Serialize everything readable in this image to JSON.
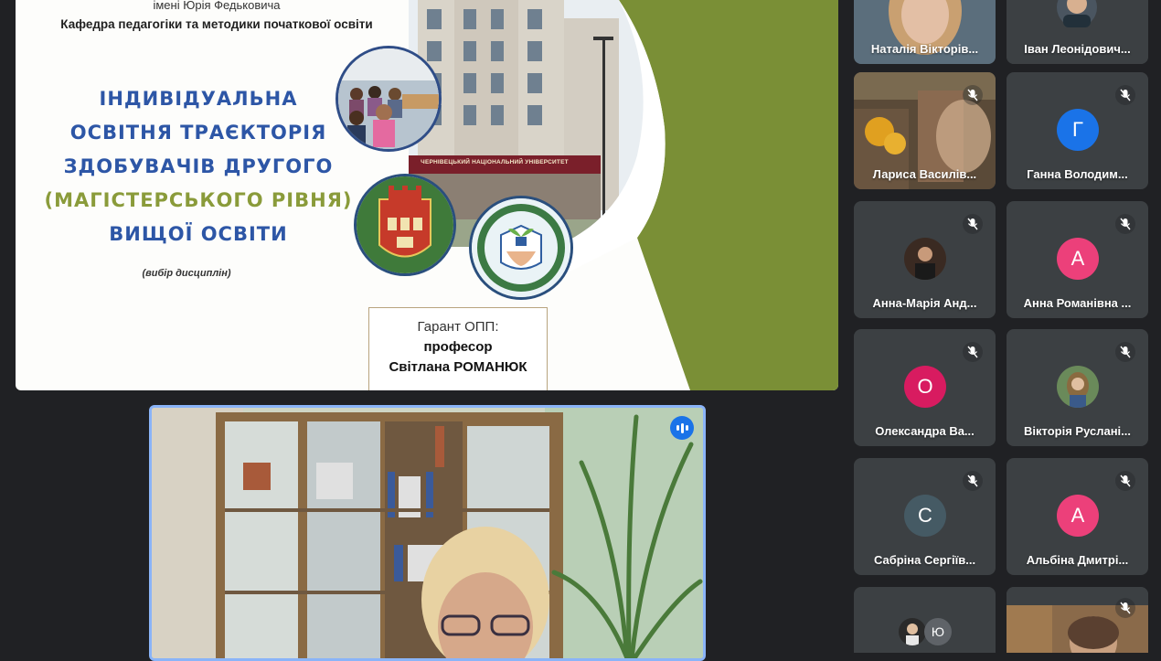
{
  "slide": {
    "subtitle_top": "імені Юрія Федьковича",
    "department": "Кафедра педагогіки та методики початкової освіти",
    "title_lines": [
      "ІНДИВІДУАЛЬНА",
      "ОСВІТНЯ ТРАЄКТОРІЯ",
      "ЗДОБУВАЧІВ ДРУГОГО",
      "(МАГІСТЕРСЬКОГО РІВНЯ)",
      "ВИЩОЇ ОСВІТИ"
    ],
    "choice": "(вибір дисциплін)",
    "guarantor": {
      "label": "Гарант ОПП:",
      "role": "професор",
      "name": "Світлана РОМАНЮК"
    },
    "university_sign": "ЧЕРНІВЕЦЬКИЙ НАЦІОНАЛЬНИЙ УНІВЕРСИТЕТ",
    "colors": {
      "green": "#7a8f36",
      "title_blue": "#2d56a6",
      "title_green": "#8a9b3a"
    }
  },
  "participants": [
    {
      "name": "Наталія Вікторів...",
      "type": "video",
      "muted": false
    },
    {
      "name": "Іван Леонідович...",
      "type": "video",
      "muted": false
    },
    {
      "name": "Лариса Василів...",
      "type": "video",
      "muted": true
    },
    {
      "name": "Ганна Володим...",
      "type": "avatar",
      "initial": "Г",
      "color": "#1a73e8",
      "muted": true
    },
    {
      "name": "Анна-Марія Анд...",
      "type": "photo",
      "muted": true
    },
    {
      "name": "Анна Романівна ...",
      "type": "avatar",
      "initial": "А",
      "color": "#ec407a",
      "muted": true
    },
    {
      "name": "Олександра Ва...",
      "type": "avatar",
      "initial": "О",
      "color": "#d81b60",
      "muted": true
    },
    {
      "name": "Вікторія Руслані...",
      "type": "photo",
      "muted": true
    },
    {
      "name": "Сабріна Сергіїв...",
      "type": "avatar",
      "initial": "С",
      "color": "#455a64",
      "muted": true
    },
    {
      "name": "Альбіна Дмитрі...",
      "type": "avatar",
      "initial": "А",
      "color": "#ec407a",
      "muted": true
    },
    {
      "name": "",
      "type": "group",
      "initial": "Ю",
      "muted": false
    },
    {
      "name": "",
      "type": "video",
      "muted": true
    }
  ],
  "speaker": {
    "speaking": true
  }
}
